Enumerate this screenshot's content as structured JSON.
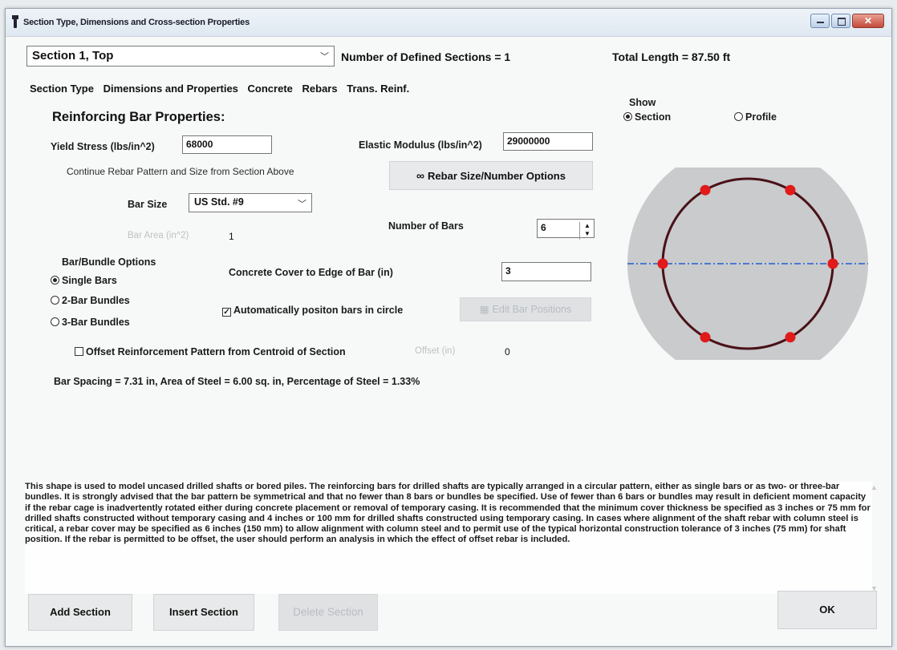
{
  "window": {
    "title": "Section Type, Dimensions and Cross-section Properties"
  },
  "header": {
    "section_selected": "Section 1, Top",
    "defined_sections": "Number of Defined Sections = 1",
    "total_length": "Total Length = 87.50 ft"
  },
  "tabs": [
    "Section Type",
    "Dimensions and Properties",
    "Concrete",
    "Rebars",
    "Trans. Reinf."
  ],
  "rebar": {
    "heading": "Reinforcing Bar Properties:",
    "yield_label": "Yield Stress (lbs/in^2)",
    "yield_value": "68000",
    "elastic_label": "Elastic Modulus (lbs/in^2)",
    "elastic_value": "29000000",
    "continue_label": "Continue Rebar Pattern and Size from Section Above",
    "size_options_button": "Rebar Size/Number Options",
    "bar_size_label": "Bar Size",
    "bar_size_value": "US Std. #9",
    "bar_area_label": "Bar Area (in^2)",
    "bar_area_value": "1",
    "num_bars_label": "Number of Bars",
    "num_bars_value": "6",
    "bundle_heading": "Bar/Bundle Options",
    "bundle_options": [
      "Single Bars",
      "2-Bar Bundles",
      "3-Bar Bundles"
    ],
    "cover_label": "Concrete Cover to Edge of Bar (in)",
    "cover_value": "3",
    "auto_position_label": "Automatically positon bars in circle",
    "edit_positions_button": "Edit Bar Positions",
    "offset_label": "Offset Reinforcement Pattern from Centroid of Section",
    "offset_value_label": "Offset (in)",
    "offset_value": "0",
    "summary": "Bar Spacing = 7.31 in, Area of Steel = 6.00 sq. in, Percentage of Steel = 1.33%"
  },
  "show": {
    "heading": "Show",
    "options": [
      "Section",
      "Profile"
    ]
  },
  "note": "This shape is used to model uncased drilled shafts or bored piles. The reinforcing bars for drilled shafts are typically arranged in a circular pattern, either as single bars or as two- or three-bar bundles. It is strongly advised that the bar pattern be symmetrical and that no fewer than 8 bars or bundles be specified. Use of fewer than 6 bars or bundles may result in deficient moment capacity if the rebar cage is inadvertently rotated either during concrete placement or removal of temporary casing. It is recommended that the minimum cover thickness be specified as 3 inches or 75 mm for drilled shafts constructed without temporary casing and 4 inches or 100 mm for drilled shafts constructed using temporary casing. In cases where alignment of the shaft rebar with column steel is critical, a rebar cover may be specified as 6 inches (150 mm) to allow alignment with column steel and to permit use of the typical horizontal construction tolerance of 3 inches (75 mm) for shaft position. If the rebar is permitted to be offset, the user should perform an analysis in which the effect of offset rebar is included.",
  "buttons": {
    "add": "Add Section",
    "insert": "Insert Section",
    "delete": "Delete Section",
    "ok": "OK"
  },
  "colors": {
    "rebar": "#e11a1a",
    "concrete": "#c9cbcd",
    "cage": "#4a1218",
    "axis": "#1f5fd0"
  }
}
